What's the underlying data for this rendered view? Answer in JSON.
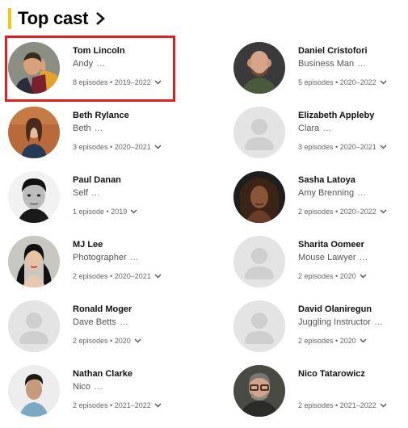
{
  "section": {
    "title": "Top cast"
  },
  "cast": [
    {
      "name": "Tom Lincoln",
      "role": "Andy",
      "episodes": "8 episodes",
      "years": "2019–2022",
      "photo": "tom"
    },
    {
      "name": "Daniel Cristofori",
      "role": "Business Man",
      "episodes": "5 episodes",
      "years": "2020–2022",
      "photo": "daniel"
    },
    {
      "name": "Beth Rylance",
      "role": "Beth",
      "episodes": "3 episodes",
      "years": "2020–2021",
      "photo": "beth"
    },
    {
      "name": "Elizabeth Appleby",
      "role": "Clara",
      "episodes": "3 episodes",
      "years": "2020–2021",
      "photo": "placeholder"
    },
    {
      "name": "Paul Danan",
      "role": "Self",
      "episodes": "1 episode",
      "years": "2019",
      "photo": "paul"
    },
    {
      "name": "Sasha Latoya",
      "role": "Amy Brenning",
      "episodes": "2 episodes",
      "years": "2020–2022",
      "photo": "sasha"
    },
    {
      "name": "MJ Lee",
      "role": "Photographer",
      "episodes": "2 episodes",
      "years": "2020–2021",
      "photo": "mj"
    },
    {
      "name": "Sharita Oomeer",
      "role": "Mouse Lawyer",
      "episodes": "2 episodes",
      "years": "2020",
      "photo": "placeholder"
    },
    {
      "name": "Ronald Moger",
      "role": "Dave Betts",
      "episodes": "2 episodes",
      "years": "2020",
      "photo": "placeholder"
    },
    {
      "name": "David Olaniregun",
      "role": "Juggling Instructor",
      "episodes": "2 episodes",
      "years": "2020",
      "photo": "placeholder"
    },
    {
      "name": "Nathan Clarke",
      "role": "Nico",
      "episodes": "2 episodes",
      "years": "2021–2022",
      "photo": "nathan"
    },
    {
      "name": "Nico Tatarowicz",
      "role": "",
      "episodes": "2 episodes",
      "years": "2021–2022",
      "photo": "nico"
    }
  ],
  "colors": {
    "accent": "#f5c518",
    "highlight": "#e0201f"
  }
}
